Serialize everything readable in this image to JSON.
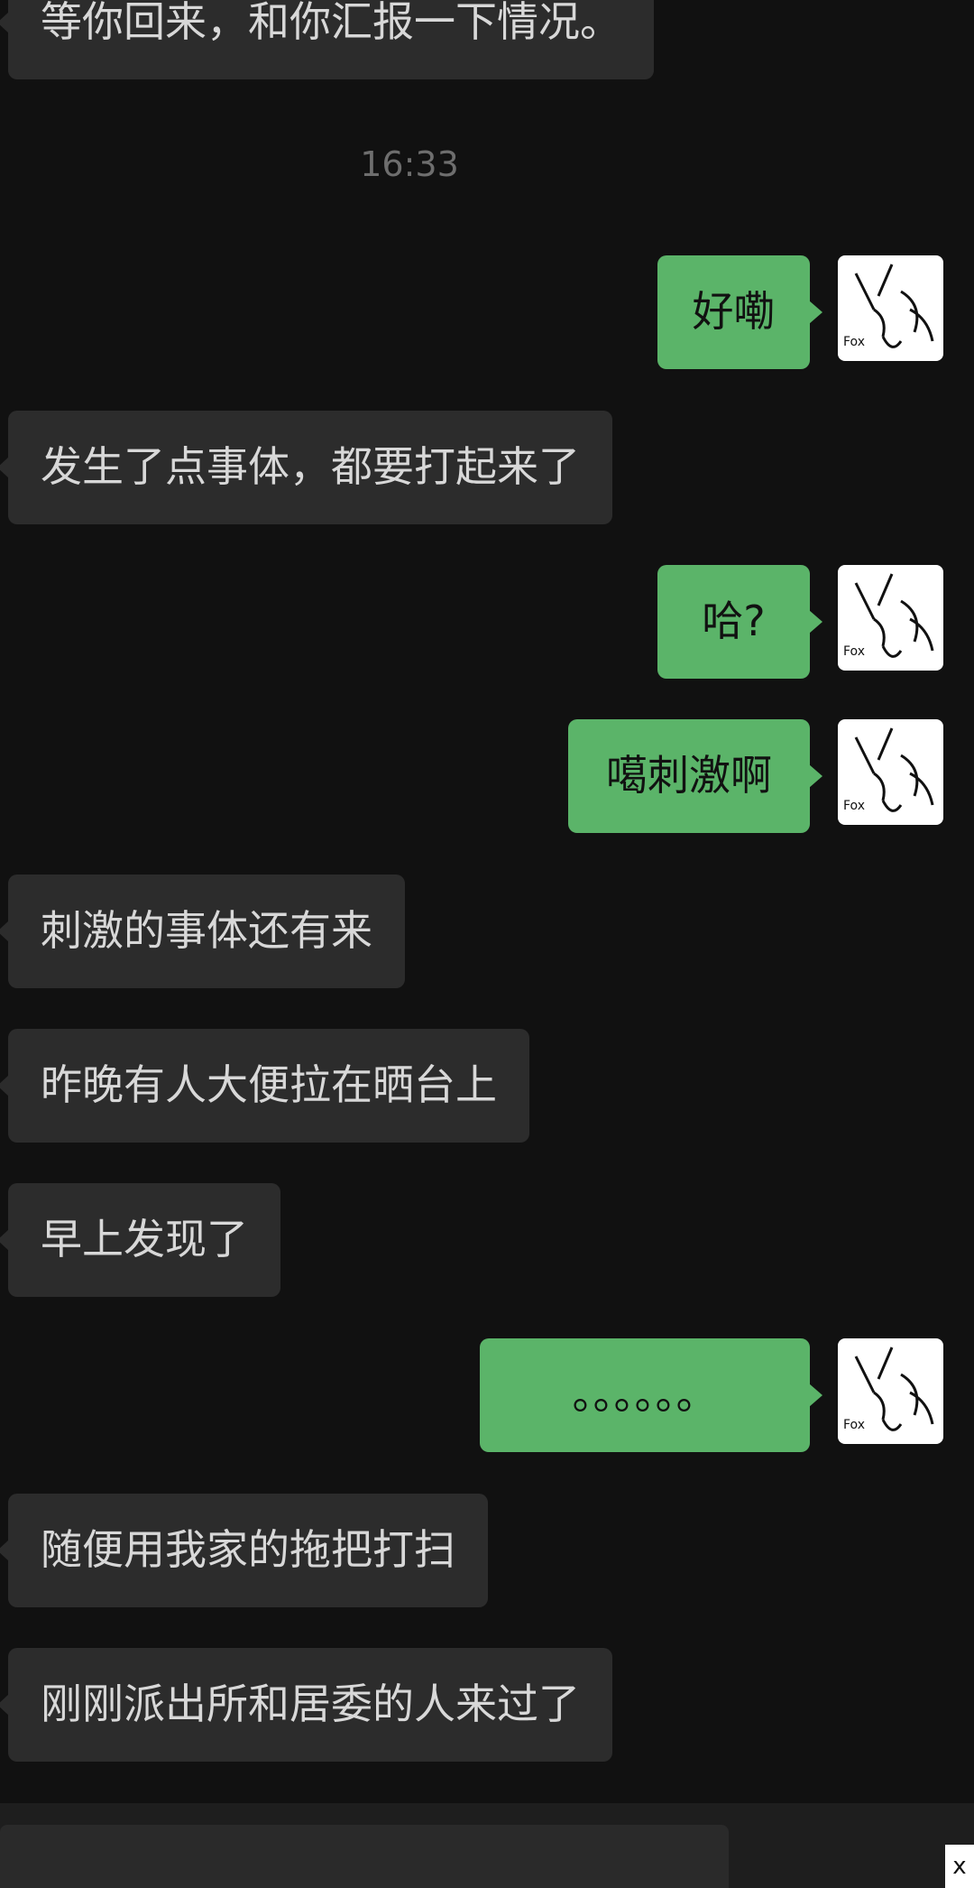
{
  "messages": [
    {
      "side": "in",
      "text": "等你回来，和你汇报一下情况。"
    },
    {
      "side": "out",
      "text": "好嘞"
    },
    {
      "side": "in",
      "text": "发生了点事体，都要打起来了"
    },
    {
      "side": "out",
      "text": "哈?"
    },
    {
      "side": "out",
      "text": "噶刺激啊"
    },
    {
      "side": "in",
      "text": "刺激的事体还有来"
    },
    {
      "side": "in",
      "text": "昨晚有人大便拉在晒台上"
    },
    {
      "side": "in",
      "text": "早上发现了"
    },
    {
      "side": "out",
      "text": "。。。。。。"
    },
    {
      "side": "in",
      "text": "随便用我家的拖把打扫"
    },
    {
      "side": "in",
      "text": "刚刚派出所和居委的人来过了"
    }
  ],
  "timestamp": "16:33",
  "avatar": {
    "icon": "fox-sketch-icon",
    "text": "Fox"
  },
  "close_label": "x",
  "colors": {
    "background": "#111111",
    "incoming_bubble": "#2c2c2c",
    "outgoing_bubble": "#5bb469",
    "incoming_text": "#d8d8d8",
    "timestamp": "#6e6e6e"
  }
}
